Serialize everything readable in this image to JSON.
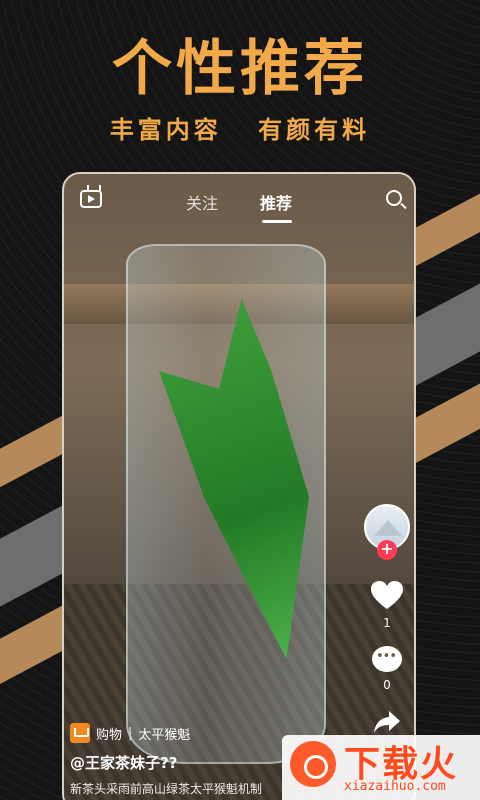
{
  "promo": {
    "headline": "个性推荐",
    "subline": "丰富内容  有颜有料"
  },
  "topbar": {
    "tabs": [
      {
        "label": "关注",
        "active": false
      },
      {
        "label": "推荐",
        "active": true
      }
    ],
    "left_icon": "tv-play-icon",
    "right_icon": "search-icon"
  },
  "rail": {
    "follow_plus": "+",
    "like_count": "1",
    "comment_count": "0"
  },
  "info": {
    "shop_label": "购物",
    "shop_product": "太平猴魁",
    "author": "@王家茶妹子??",
    "description": "新茶头采雨前高山绿茶太平猴魁机制"
  },
  "watermark": {
    "brand": "下载火",
    "url": "xiazaihuo.com"
  },
  "colors": {
    "accent": "#f2a94a",
    "like_red": "#ff3a55",
    "cart_orange": "#f08a20",
    "watermark_red": "#ff4a1e"
  }
}
